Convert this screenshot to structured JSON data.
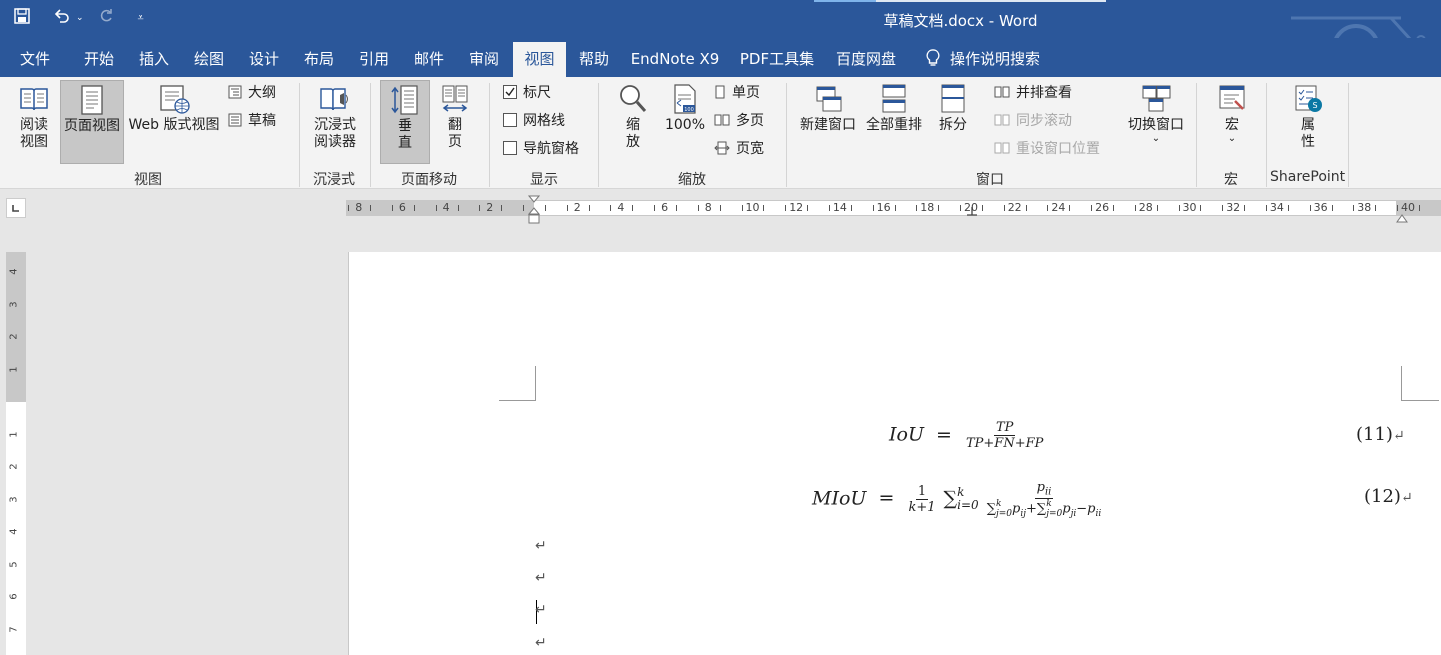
{
  "window": {
    "title": "草稿文档.docx  -  Word"
  },
  "tabs": [
    {
      "label": "文件"
    },
    {
      "label": "开始"
    },
    {
      "label": "插入"
    },
    {
      "label": "绘图"
    },
    {
      "label": "设计"
    },
    {
      "label": "布局"
    },
    {
      "label": "引用"
    },
    {
      "label": "邮件"
    },
    {
      "label": "审阅"
    },
    {
      "label": "视图",
      "active": true
    },
    {
      "label": "帮助"
    },
    {
      "label": "EndNote X9"
    },
    {
      "label": "PDF工具集"
    },
    {
      "label": "百度网盘"
    },
    {
      "label": "操作说明搜索"
    }
  ],
  "ribbon": {
    "view": {
      "read_mode_1": "阅读",
      "read_mode_2": "视图",
      "print_layout": "页面视图",
      "web_layout": "Web 版式视图",
      "outline": "大纲",
      "draft": "草稿",
      "group": "视图"
    },
    "immersive": {
      "reader_1": "沉浸式",
      "reader_2": "阅读器",
      "group": "沉浸式"
    },
    "page_movement": {
      "vertical_1": "垂",
      "vertical_2": "直",
      "side_1": "翻",
      "side_2": "页",
      "group": "页面移动"
    },
    "show": {
      "ruler": "标尺",
      "ruler_checked": true,
      "gridlines": "网格线",
      "gridlines_checked": false,
      "nav_pane": "导航窗格",
      "nav_pane_checked": false,
      "group": "显示"
    },
    "zoom": {
      "zoom_1": "缩",
      "zoom_2": "放",
      "hundred": "100%",
      "one_page": "单页",
      "multi_page": "多页",
      "page_width": "页宽",
      "group": "缩放"
    },
    "window": {
      "new_window": "新建窗口",
      "arrange_all": "全部重排",
      "split": "拆分",
      "side_by_side": "并排查看",
      "sync_scroll": "同步滚动",
      "reset_position": "重设窗口位置",
      "switch_windows": "切换窗口",
      "group": "窗口"
    },
    "macros": {
      "macros": "宏",
      "group": "宏"
    },
    "sharepoint": {
      "properties_1": "属",
      "properties_2": "性",
      "group": "SharePoint"
    }
  },
  "hruler": {
    "left_labels": [
      "8",
      "6",
      "4",
      "2"
    ],
    "right_labels": [
      "2",
      "4",
      "6",
      "8",
      "10",
      "12",
      "14",
      "16",
      "18",
      "20",
      "22",
      "24",
      "26",
      "28",
      "30",
      "32",
      "34",
      "36",
      "38",
      "40"
    ]
  },
  "vruler": {
    "top_labels": [
      "4",
      "3",
      "2",
      "1"
    ],
    "bottom_labels": [
      "1",
      "2",
      "3",
      "4",
      "5",
      "6",
      "7"
    ]
  },
  "document": {
    "eq1": {
      "lhs": "IoU",
      "eq": "=",
      "num": "TP",
      "den": "TP+FN+FP",
      "number": "(11)"
    },
    "eq2": {
      "lhs": "MIoU",
      "eq": "=",
      "frac_num": "1",
      "frac_den": "k+1",
      "sum": "∑",
      "sum_sup": "k",
      "sum_sub": "i=0",
      "num": "p",
      "num_sub": "ii",
      "den_a": "∑",
      "den_a_sup": "k",
      "den_a_sub": "j=0",
      "den_b": "p",
      "den_b_sub": "ij",
      "den_plus": "+∑",
      "den_c_sup": "k",
      "den_c_sub": "j=0",
      "den_d": "p",
      "den_d_sub": "ji",
      "den_minus": "−p",
      "den_e_sub": "ii",
      "number": "(12)"
    },
    "para_mark": "↵"
  }
}
